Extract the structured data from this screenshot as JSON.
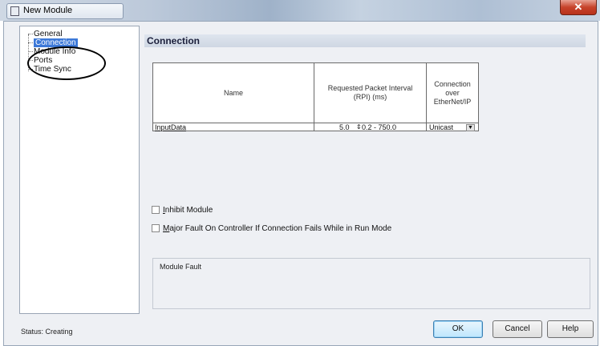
{
  "window": {
    "title": "New Module",
    "close_glyph": "✕"
  },
  "tree": {
    "items": [
      {
        "label": "General",
        "selected": false
      },
      {
        "label": "Connection",
        "selected": true
      },
      {
        "label": "Module Info",
        "selected": false
      },
      {
        "label": "Ports",
        "selected": false
      },
      {
        "label": "Time Sync",
        "selected": false
      }
    ]
  },
  "panel": {
    "heading": "Connection",
    "table": {
      "columns": [
        "Name",
        "Requested Packet Interval (RPI) (ms)",
        "Connection over EtherNet/IP"
      ],
      "rows": [
        {
          "name": "InputData",
          "rpi": "5.0",
          "range": "0.2 - 750.0",
          "connection": "Unicast"
        }
      ],
      "spinner_glyph": "⇕",
      "dropdown_glyph": "▼"
    },
    "checkboxes": {
      "inhibit": {
        "mnemonic": "I",
        "rest": "nhibit Module",
        "checked": false
      },
      "major_fault": {
        "mnemonic": "M",
        "rest": "ajor Fault On Controller If Connection Fails While in Run Mode",
        "checked": false
      }
    },
    "module_fault_label": "Module Fault"
  },
  "status": "Status:  Creating",
  "buttons": {
    "ok": "OK",
    "cancel": "Cancel",
    "help": "Help"
  },
  "colors": {
    "selection": "#3d79d8",
    "close": "#c7432b"
  }
}
